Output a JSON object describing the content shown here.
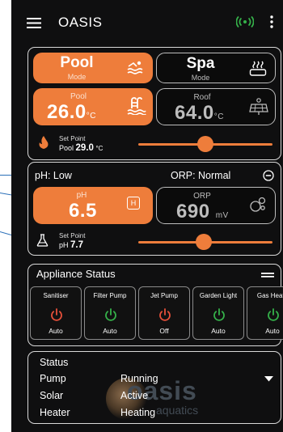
{
  "header": {
    "title": "OASIS"
  },
  "mode": {
    "pool_label": "Pool",
    "pool_sub": "Mode",
    "spa_label": "Spa",
    "spa_sub": "Mode"
  },
  "temps": {
    "pool_label": "Pool",
    "pool_value": "26.0",
    "pool_unit": "°C",
    "roof_label": "Roof",
    "roof_value": "64.0",
    "roof_unit": "°C",
    "setpoint_label": "Set Point",
    "setpoint_name": "Pool",
    "setpoint_value": "29.0",
    "setpoint_unit": "°C",
    "setpoint_level": 0.5
  },
  "chem": {
    "ph_status": "pH: Low",
    "orp_status": "ORP: Normal",
    "ph_label": "pH",
    "ph_value": "6.5",
    "ph_badge": "H",
    "orp_label": "ORP",
    "orp_value": "690",
    "orp_unit": "mV",
    "setpoint_label": "Set Point",
    "setpoint_name": "pH",
    "setpoint_value": "7.7",
    "setpoint_level": 0.49
  },
  "appliances": {
    "title": "Appliance Status",
    "items": [
      {
        "name": "Sanitiser",
        "state": "Auto",
        "color": "#e8503a"
      },
      {
        "name": "Filter Pump",
        "state": "Auto",
        "color": "#35b24a"
      },
      {
        "name": "Jet Pump",
        "state": "Off",
        "color": "#e8503a"
      },
      {
        "name": "Garden Light",
        "state": "Auto",
        "color": "#35b24a"
      },
      {
        "name": "Gas Heate",
        "state": "Auto",
        "color": "#35b24a"
      }
    ]
  },
  "status": {
    "title": "Status",
    "rows": [
      {
        "label": "Pump",
        "value": "Running"
      },
      {
        "label": "Solar",
        "value": "Active"
      },
      {
        "label": "Heater",
        "value": "Heating"
      }
    ],
    "watermark_brand": "oasis",
    "watermark_sub": "aquatics"
  },
  "colors": {
    "accent": "#ee7d3b",
    "connected": "#35b24a",
    "off": "#e8503a"
  }
}
